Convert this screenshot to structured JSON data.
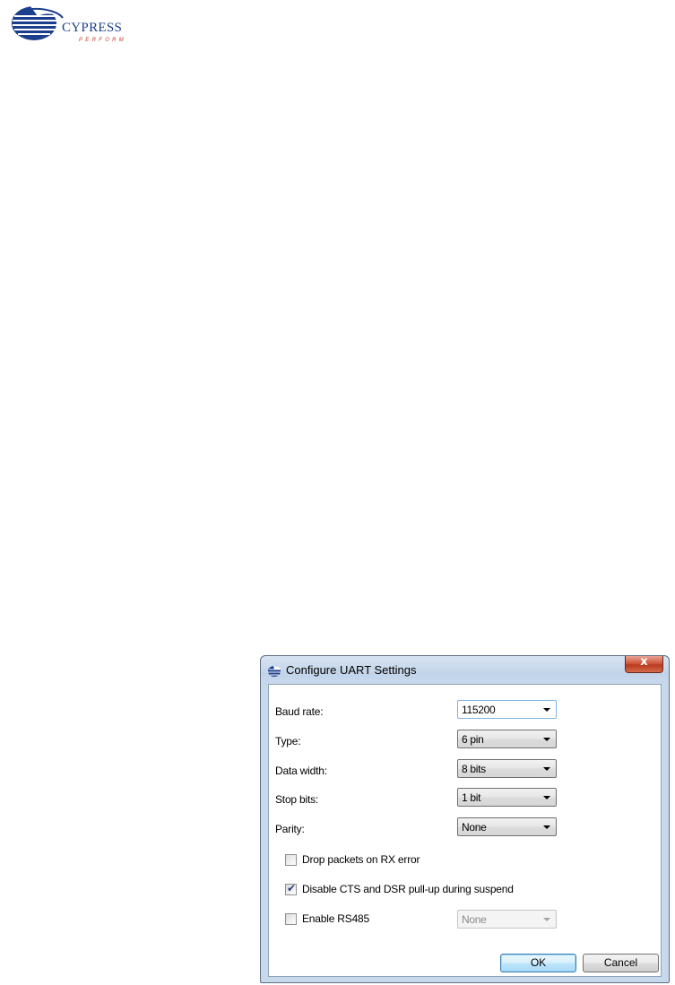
{
  "logo": {
    "name": "CYPRESS",
    "tagline": "PERFORM"
  },
  "dialog": {
    "title": "Configure UART Settings",
    "close_label": "x",
    "fields": {
      "baud_rate": {
        "label": "Baud rate:",
        "value": "115200"
      },
      "type": {
        "label": "Type:",
        "value": "6 pin"
      },
      "data_width": {
        "label": "Data width:",
        "value": "8 bits"
      },
      "stop_bits": {
        "label": "Stop bits:",
        "value": "1 bit"
      },
      "parity": {
        "label": "Parity:",
        "value": "None"
      }
    },
    "checkboxes": {
      "drop_packets": {
        "label": "Drop packets on RX error",
        "checked": false
      },
      "disable_pullup": {
        "label": "Disable CTS and DSR pull-up during suspend",
        "checked": true
      },
      "enable_rs485": {
        "label": "Enable RS485",
        "checked": false,
        "select_value": "None"
      }
    },
    "buttons": {
      "ok": "OK",
      "cancel": "Cancel"
    }
  },
  "colors": {
    "brand_blue": "#1b3f8c",
    "brand_red": "#c0392b",
    "close_red": "#c9452a"
  }
}
